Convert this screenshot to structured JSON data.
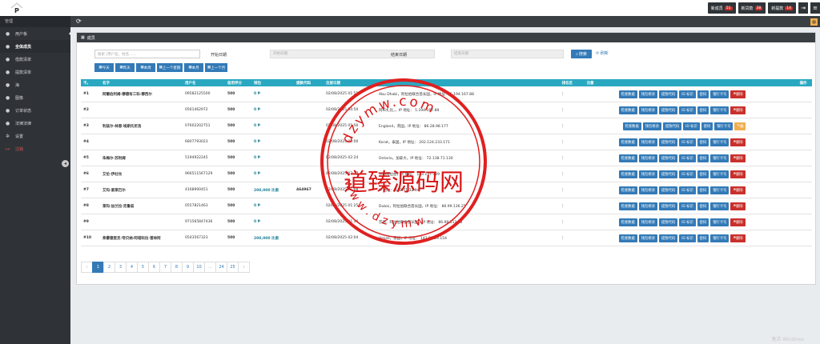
{
  "topbar": {
    "badges": [
      {
        "label": "新成员",
        "count": "51"
      },
      {
        "label": "新贷款",
        "count": "38"
      },
      {
        "label": "新提款",
        "count": "14"
      }
    ]
  },
  "sidebar": {
    "section_title": "管理",
    "items": [
      {
        "label": "用户板"
      },
      {
        "label": "全体成员"
      },
      {
        "label": "借款清单"
      },
      {
        "label": "提款清单"
      },
      {
        "label": "海"
      },
      {
        "label": "图像"
      },
      {
        "label": "订单状态"
      },
      {
        "label": "法律法律"
      },
      {
        "label": "设置"
      },
      {
        "label": "注销"
      }
    ]
  },
  "panel": {
    "title": "成员",
    "search_placeholder": "搜索 [用户名，姓名......",
    "start_label": "开始日期",
    "start_placeholder": "开始日期",
    "end_label": "结束日期",
    "end_placeholder": "结束日期",
    "search_button": "搜索",
    "reset_link": "刷新",
    "quick_filters": [
      "今天",
      "昨天",
      "本周",
      "上一个星期",
      "本月",
      "上一个月"
    ]
  },
  "table": {
    "headers": [
      "不。",
      "名字",
      "用户名",
      "信用评分",
      "钱包",
      "提款代码",
      "注册日期",
      "",
      "",
      "",
      "排名区",
      "注意",
      "操作"
    ],
    "rows": [
      {
        "no": "#1",
        "name": "阿爾伯利姆·穆德有三科·穆西尔",
        "user": "09582125500",
        "score": "500",
        "wallet": "0 ₱",
        "code": "",
        "date": "02/08/2025 01:51",
        "info": "Abu Dhabi，阿拉伯联合酋长国，IP 地址： 5.194.167.88",
        "last": "删除"
      },
      {
        "no": "#2",
        "name": "",
        "user": "0561462972",
        "score": "500",
        "wallet": "0 ₱",
        "code": "",
        "date": "02/08/2025 04:50",
        "info": "阿布扎比，，IP 地址： 5.194.167.88",
        "last": "删除"
      },
      {
        "no": "#3",
        "name": "利兹尔·林恩·埃斯托尼洛",
        "user": "07602202751",
        "score": "500",
        "wallet": "0 ₱",
        "code": "",
        "date": "02/08/2025 01:56",
        "info": "England，英国，IP 地址： 86.28.98.177",
        "last": "编"
      },
      {
        "no": "#4",
        "name": "",
        "user": "6807793023",
        "score": "500",
        "wallet": "0 ₱",
        "code": "",
        "date": "02/08/2025 03:00",
        "info": "Korat，泰国，IP 地址： 202.124.233.171",
        "last": "删除"
      },
      {
        "no": "#5",
        "name": "朱梅尔·苏利姆",
        "user": "5194922245",
        "score": "500",
        "wallet": "0 ₱",
        "code": "",
        "date": "02/08/2025 02:24",
        "info": "Ontario，加拿大，IP 地址： 72.138.71.130",
        "last": "删除"
      },
      {
        "no": "#6",
        "name": "艾伦·伊杜坎",
        "user": "966511567129",
        "score": "500",
        "wallet": "0 ₱",
        "code": "",
        "date": "02/08/2025 02:27",
        "info": "沙特阿拉伯，IP 地址： 143.137.129",
        "last": "删除"
      },
      {
        "no": "#7",
        "name": "艾玛·索莱巴尔",
        "user": "4168900451",
        "score": "500",
        "wallet": "200,000 比索",
        "code": "464967",
        "date": "02/08/2025 01:08",
        "info": "IP 地址： 108.71.32.94",
        "last": "删除"
      },
      {
        "no": "#8",
        "name": "莱玛·加兰拉·克鲁兹",
        "user": "0557821463",
        "score": "500",
        "wallet": "0 ₱",
        "code": "",
        "date": "02/08/2025 01:25",
        "info": "Dubai，阿拉伯联合酋长国，IP 地址： 86.99.136.25",
        "last": "删除"
      },
      {
        "no": "#9",
        "name": "",
        "user": "971565847436",
        "score": "500",
        "wallet": "0 ₱",
        "code": "",
        "date": "02/08/2025 01:16",
        "info": "莎迦，阿拉伯联合酋长国，IP 地址： 86.98.112.12",
        "last": "删除"
      },
      {
        "no": "#10",
        "name": "弗雷德里克·夸贝纳·阿塔科拉·普林阿",
        "user": "0543567323",
        "score": "500",
        "wallet": "200,000 比索",
        "code": "",
        "date": "02/08/2025 02:04",
        "info": "Hesse，德国，IP 地址： 142.98.39.154",
        "last": "删除"
      }
    ],
    "row_actions": [
      "检查数据",
      "钱包修改",
      "提款代码",
      "ID 标识",
      "密码",
      "银行卡号"
    ]
  },
  "pagination": {
    "prev": "‹",
    "pages": [
      "1",
      "2",
      "3",
      "4",
      "5",
      "6",
      "7",
      "8",
      "9",
      "10",
      "...",
      "24",
      "25"
    ],
    "next": "›",
    "active": "1"
  },
  "watermark": {
    "center_text": "道臻源码网",
    "ring_top": "dzymw.com",
    "ring_bottom": "www.dzymw."
  },
  "activate_text": "激活 Windows"
}
